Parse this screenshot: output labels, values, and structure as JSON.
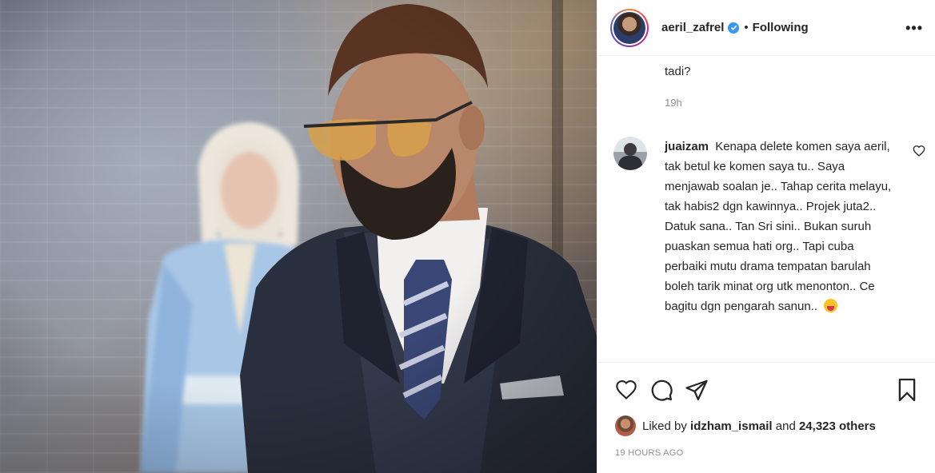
{
  "post": {
    "image_alt": "Photo of a bearded man in sunglasses and a navy suit, with a woman in a hijab and light blue dress blurred in the background against a brick wall"
  },
  "header": {
    "username": "aeril_zafrel",
    "separator": "•",
    "follow_status": "Following",
    "more_label": "•••"
  },
  "previous_comment": {
    "text_tail": "tadi?",
    "time": "19h"
  },
  "comment": {
    "username": "juaizam",
    "text": "Kenapa delete komen saya aeril, tak betul ke komen saya tu.. Saya menjawab soalan je.. Tahap cerita melayu, tak habis2 dgn kawinnya.. Projek juta2.. Datuk sana.. Tan Sri sini.. Bukan suruh puaskan semua hati org.. Tapi cuba perbaiki mutu drama tempatan barulah boleh tarik minat org utk menonton.. Ce bagitu dgn pengarah sanun..",
    "emoji": "😛"
  },
  "likes": {
    "prefix": "Liked by",
    "user": "idzham_ismail",
    "middle": "and",
    "others": "24,323 others"
  },
  "timestamp": "19 HOURS AGO",
  "icons": {
    "like": "heart-icon",
    "comment": "comment-bubble-icon",
    "share": "paper-plane-icon",
    "save": "bookmark-icon",
    "verified": "verified-badge-icon"
  },
  "colors": {
    "text": "#262626",
    "muted": "#8e8e8e",
    "verified": "#3897f0",
    "border": "#efefef"
  }
}
